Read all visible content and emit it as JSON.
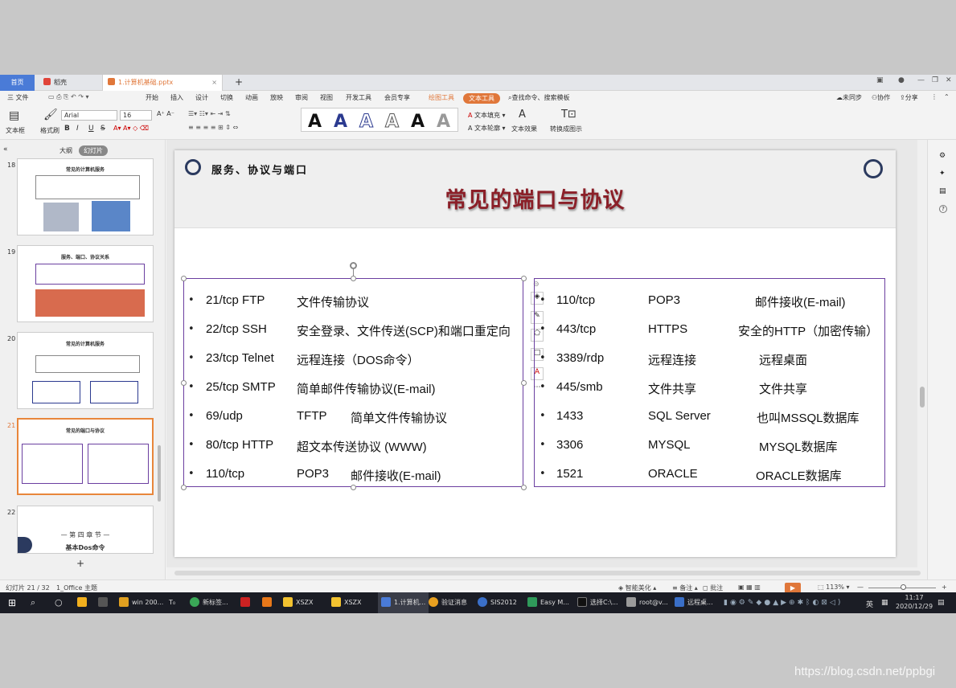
{
  "tabs": {
    "home": "首页",
    "straw": "稻壳",
    "file": "1.计算机基础.pptx",
    "new": "+"
  },
  "menu": {
    "file": "三 文件",
    "items": [
      "开始",
      "插入",
      "设计",
      "切换",
      "动画",
      "放映",
      "审阅",
      "视图",
      "开发工具",
      "会员专享"
    ],
    "draw_tools": "绘图工具",
    "text_tools": "文本工具",
    "search": "查找命令、搜索模板",
    "right": [
      "未同步",
      "协作",
      "分享"
    ]
  },
  "toolbar": {
    "textbox": "文本框",
    "format_painter": "格式刷",
    "font": "Arial",
    "size": "16",
    "bold": "B",
    "italic": "I",
    "underline": "U",
    "strike": "S",
    "text_fill": "文本填充",
    "text_outline": "文本轮廓",
    "text_effect": "文本效果",
    "convert": "转换成图示",
    "styles": [
      "A",
      "A",
      "A",
      "A",
      "A",
      "A"
    ]
  },
  "leftpanel": {
    "outline": "大纲",
    "slides": "幻灯片",
    "thumbs": [
      {
        "num": "18",
        "title": "常见的计算机服务"
      },
      {
        "num": "19",
        "title": "服务、端口、协议关系"
      },
      {
        "num": "20",
        "title": "常见的计算机服务"
      },
      {
        "num": "21",
        "title": "常见的端口与协议"
      },
      {
        "num": "22",
        "chapter": "— 第 四 章 节 —",
        "chapter_title": "基本Dos命令"
      }
    ],
    "add": "+"
  },
  "slide": {
    "subtitle": "服务、协议与端口",
    "title": "常见的端口与协议",
    "left_rows": [
      {
        "port": "21/tcp FTP",
        "desc": "文件传输协议"
      },
      {
        "port": "22/tcp SSH",
        "desc": "安全登录、文件传送(SCP)和端口重定向"
      },
      {
        "port": "23/tcp Telnet",
        "desc": "远程连接（DOS命令）"
      },
      {
        "port": "25/tcp SMTP",
        "desc": "简单邮件传输协议(E-mail)"
      },
      {
        "port": "69/udp",
        "proto": "TFTP",
        "desc": "简单文件传输协议"
      },
      {
        "port": "80/tcp HTTP",
        "desc": "超文本传送协议 (WWW)"
      },
      {
        "port": "110/tcp",
        "proto": "POP3",
        "desc": "邮件接收(E-mail)"
      }
    ],
    "right_rows": [
      {
        "port": "110/tcp",
        "proto": "POP3",
        "desc": "邮件接收(E-mail)"
      },
      {
        "port": "443/tcp",
        "proto": "HTTPS",
        "desc": "安全的HTTP（加密传输）"
      },
      {
        "port": "3389/rdp",
        "proto": "远程连接",
        "desc": "远程桌面"
      },
      {
        "port": "445/smb",
        "proto": "文件共享",
        "desc": "文件共享"
      },
      {
        "port": "1433",
        "proto": "SQL Server",
        "desc": "也叫MSSQL数据库"
      },
      {
        "port": "3306",
        "proto": "MYSQL",
        "desc": "MYSQL数据库"
      },
      {
        "port": "1521",
        "proto": "ORACLE",
        "desc": "ORACLE数据库"
      }
    ]
  },
  "status": {
    "slide_no": "幻灯片 21 / 32",
    "theme": "1_Office 主题",
    "beautify": "智能美化",
    "notes": "备注",
    "comment": "批注",
    "zoom": "113%"
  },
  "taskbar": {
    "items": [
      "win 200...",
      "新标签...",
      "XSZX",
      "XSZX",
      "1.计算机...",
      "验证消息",
      "SIS2012",
      "Easy M...",
      "选择C:\\...",
      "root@v...",
      "远程桌..."
    ],
    "lang": "英",
    "time": "11:17",
    "date": "2020/12/29"
  },
  "watermark": "https://blog.csdn.net/ppbgi",
  "colors": {
    "accent": "#4a7bd7",
    "orange": "#e0773a",
    "title": "#8b1f28",
    "box": "#6b3fa0"
  }
}
